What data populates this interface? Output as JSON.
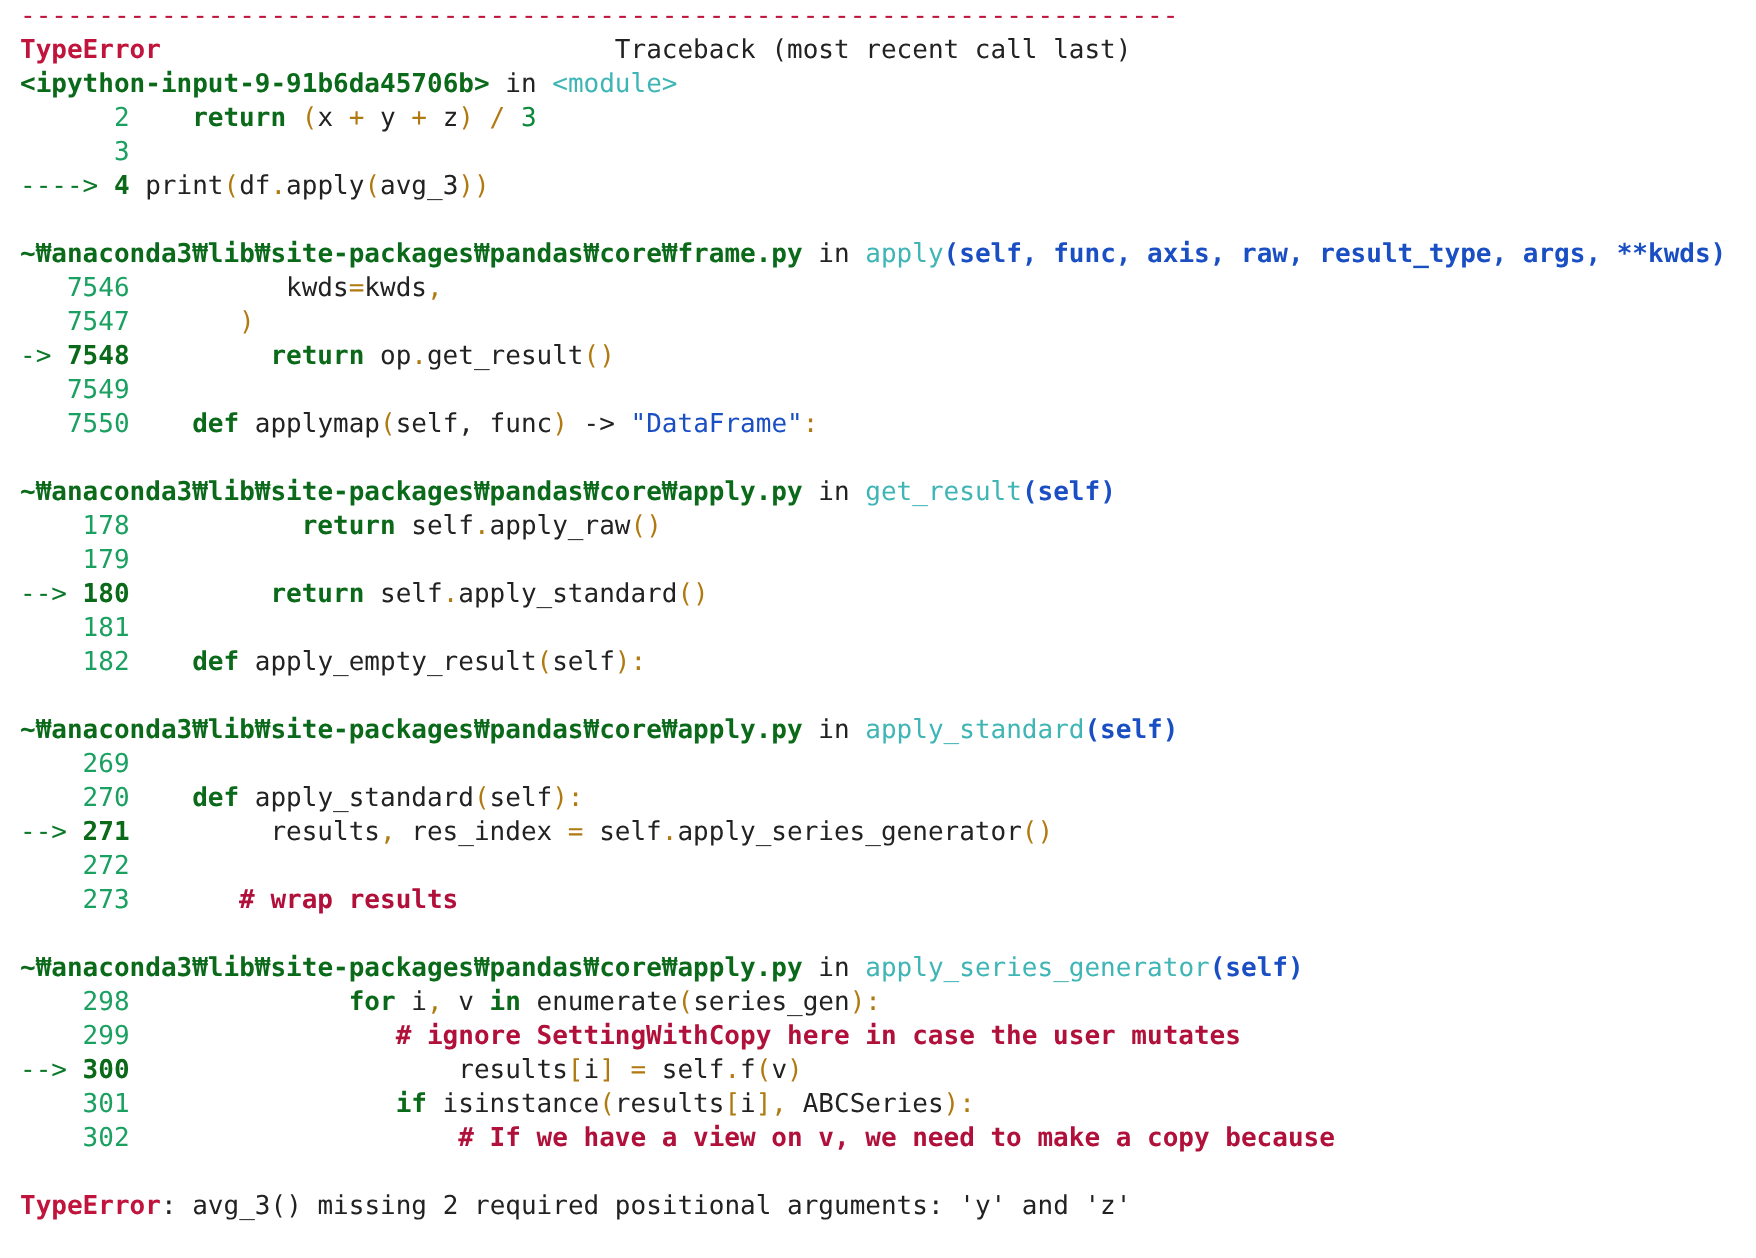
{
  "separator": "--------------------------------------------------------------------------",
  "header": {
    "error_type": "TypeError",
    "title": "Traceback (most recent call last)"
  },
  "frames": [
    {
      "header": [
        {
          "text": "<ipython-input-9-91b6da45706b>",
          "kind": "path"
        },
        {
          "text": " in ",
          "kind": "plain"
        },
        {
          "text": "<module>",
          "kind": "func"
        }
      ],
      "lines": [
        {
          "num": "2",
          "code": [
            {
              "text": "   return",
              "kind": "kw"
            },
            {
              "text": " (",
              "kind": "op"
            },
            {
              "text": "x ",
              "kind": "plain"
            },
            {
              "text": "+",
              "kind": "op"
            },
            {
              "text": " y ",
              "kind": "plain"
            },
            {
              "text": "+",
              "kind": "op"
            },
            {
              "text": " z",
              "kind": "plain"
            },
            {
              "text": ") /",
              "kind": "op"
            },
            {
              "text": " 3",
              "kind": "num"
            }
          ]
        },
        {
          "num": "3"
        },
        {
          "arrow": "---->",
          "num": "4",
          "code": [
            {
              "text": "print",
              "kind": "plain"
            },
            {
              "text": "(",
              "kind": "op"
            },
            {
              "text": "df",
              "kind": "plain"
            },
            {
              "text": ".",
              "kind": "op"
            },
            {
              "text": "apply",
              "kind": "plain"
            },
            {
              "text": "(",
              "kind": "op"
            },
            {
              "text": "avg_3",
              "kind": "plain"
            },
            {
              "text": "))",
              "kind": "op"
            }
          ]
        }
      ]
    },
    {
      "header": [
        {
          "text": "~₩anaconda3₩lib₩site-packages₩pandas₩core₩frame.py",
          "kind": "path"
        },
        {
          "text": " in ",
          "kind": "plain"
        },
        {
          "text": "apply",
          "kind": "func"
        },
        {
          "text": "(self, func, axis, raw, result_type, args, **kwds)",
          "kind": "args"
        }
      ],
      "lines": [
        {
          "num": "7546",
          "code": [
            {
              "text": "         kwds",
              "kind": "plain"
            },
            {
              "text": "=",
              "kind": "op"
            },
            {
              "text": "kwds",
              "kind": "plain"
            },
            {
              "text": ",",
              "kind": "op"
            }
          ]
        },
        {
          "num": "7547",
          "code": [
            {
              "text": "      )",
              "kind": "op"
            }
          ]
        },
        {
          "arrow": "->",
          "num": "7548",
          "code": [
            {
              "text": "        return",
              "kind": "kw"
            },
            {
              "text": " op",
              "kind": "plain"
            },
            {
              "text": ".",
              "kind": "op"
            },
            {
              "text": "get_result",
              "kind": "plain"
            },
            {
              "text": "()",
              "kind": "op"
            }
          ]
        },
        {
          "num": "7549"
        },
        {
          "num": "7550",
          "code": [
            {
              "text": "   def",
              "kind": "kw"
            },
            {
              "text": " applymap",
              "kind": "plain"
            },
            {
              "text": "(",
              "kind": "op"
            },
            {
              "text": "self, func",
              "kind": "plain"
            },
            {
              "text": ")",
              "kind": "op"
            },
            {
              "text": " -> ",
              "kind": "plain"
            },
            {
              "text": "\"DataFrame\"",
              "kind": "str"
            },
            {
              "text": ":",
              "kind": "op"
            }
          ]
        }
      ]
    },
    {
      "header": [
        {
          "text": "~₩anaconda3₩lib₩site-packages₩pandas₩core₩apply.py",
          "kind": "path"
        },
        {
          "text": " in ",
          "kind": "plain"
        },
        {
          "text": "get_result",
          "kind": "func"
        },
        {
          "text": "(self)",
          "kind": "args"
        }
      ],
      "lines": [
        {
          "num": "178",
          "code": [
            {
              "text": "          return",
              "kind": "kw"
            },
            {
              "text": " self",
              "kind": "plain"
            },
            {
              "text": ".",
              "kind": "op"
            },
            {
              "text": "apply_raw",
              "kind": "plain"
            },
            {
              "text": "()",
              "kind": "op"
            }
          ]
        },
        {
          "num": "179"
        },
        {
          "arrow": "-->",
          "num": "180",
          "code": [
            {
              "text": "        return",
              "kind": "kw"
            },
            {
              "text": " self",
              "kind": "plain"
            },
            {
              "text": ".",
              "kind": "op"
            },
            {
              "text": "apply_standard",
              "kind": "plain"
            },
            {
              "text": "()",
              "kind": "op"
            }
          ]
        },
        {
          "num": "181"
        },
        {
          "num": "182",
          "code": [
            {
              "text": "   def",
              "kind": "kw"
            },
            {
              "text": " apply_empty_result",
              "kind": "plain"
            },
            {
              "text": "(",
              "kind": "op"
            },
            {
              "text": "self",
              "kind": "plain"
            },
            {
              "text": "):",
              "kind": "op"
            }
          ]
        }
      ]
    },
    {
      "header": [
        {
          "text": "~₩anaconda3₩lib₩site-packages₩pandas₩core₩apply.py",
          "kind": "path"
        },
        {
          "text": " in ",
          "kind": "plain"
        },
        {
          "text": "apply_standard",
          "kind": "func"
        },
        {
          "text": "(self)",
          "kind": "args"
        }
      ],
      "lines": [
        {
          "num": "269"
        },
        {
          "num": "270",
          "code": [
            {
              "text": "   def",
              "kind": "kw"
            },
            {
              "text": " apply_standard",
              "kind": "plain"
            },
            {
              "text": "(",
              "kind": "op"
            },
            {
              "text": "self",
              "kind": "plain"
            },
            {
              "text": "):",
              "kind": "op"
            }
          ]
        },
        {
          "arrow": "-->",
          "num": "271",
          "code": [
            {
              "text": "        results",
              "kind": "plain"
            },
            {
              "text": ",",
              "kind": "op"
            },
            {
              "text": " res_index ",
              "kind": "plain"
            },
            {
              "text": "=",
              "kind": "op"
            },
            {
              "text": " self",
              "kind": "plain"
            },
            {
              "text": ".",
              "kind": "op"
            },
            {
              "text": "apply_series_generator",
              "kind": "plain"
            },
            {
              "text": "()",
              "kind": "op"
            }
          ]
        },
        {
          "num": "272"
        },
        {
          "num": "273",
          "code": [
            {
              "text": "      # wrap results",
              "kind": "comment"
            }
          ]
        }
      ]
    },
    {
      "header": [
        {
          "text": "~₩anaconda3₩lib₩site-packages₩pandas₩core₩apply.py",
          "kind": "path"
        },
        {
          "text": " in ",
          "kind": "plain"
        },
        {
          "text": "apply_series_generator",
          "kind": "func"
        },
        {
          "text": "(self)",
          "kind": "args"
        }
      ],
      "lines": [
        {
          "num": "298",
          "code": [
            {
              "text": "             for",
              "kind": "kw"
            },
            {
              "text": " i",
              "kind": "plain"
            },
            {
              "text": ",",
              "kind": "op"
            },
            {
              "text": " v ",
              "kind": "plain"
            },
            {
              "text": "in",
              "kind": "kw"
            },
            {
              "text": " enumerate",
              "kind": "plain"
            },
            {
              "text": "(",
              "kind": "op"
            },
            {
              "text": "series_gen",
              "kind": "plain"
            },
            {
              "text": "):",
              "kind": "op"
            }
          ]
        },
        {
          "num": "299",
          "code": [
            {
              "text": "                # ignore SettingWithCopy here in case the user mutates",
              "kind": "comment"
            }
          ]
        },
        {
          "arrow": "-->",
          "num": "300",
          "code": [
            {
              "text": "                    results",
              "kind": "plain"
            },
            {
              "text": "[",
              "kind": "op"
            },
            {
              "text": "i",
              "kind": "plain"
            },
            {
              "text": "] =",
              "kind": "op"
            },
            {
              "text": " self",
              "kind": "plain"
            },
            {
              "text": ".",
              "kind": "op"
            },
            {
              "text": "f",
              "kind": "plain"
            },
            {
              "text": "(",
              "kind": "op"
            },
            {
              "text": "v",
              "kind": "plain"
            },
            {
              "text": ")",
              "kind": "op"
            }
          ]
        },
        {
          "num": "301",
          "code": [
            {
              "text": "                if",
              "kind": "kw"
            },
            {
              "text": " isinstance",
              "kind": "plain"
            },
            {
              "text": "(",
              "kind": "op"
            },
            {
              "text": "results",
              "kind": "plain"
            },
            {
              "text": "[",
              "kind": "op"
            },
            {
              "text": "i",
              "kind": "plain"
            },
            {
              "text": "],",
              "kind": "op"
            },
            {
              "text": " ABCSeries",
              "kind": "plain"
            },
            {
              "text": "):",
              "kind": "op"
            }
          ]
        },
        {
          "num": "302",
          "code": [
            {
              "text": "                    # If we have a view on v, we need to make a copy because",
              "kind": "comment"
            }
          ]
        }
      ]
    }
  ],
  "error": {
    "error_type": "TypeError",
    "message": ": avg_3() missing 2 required positional arguments: 'y' and 'z'"
  }
}
